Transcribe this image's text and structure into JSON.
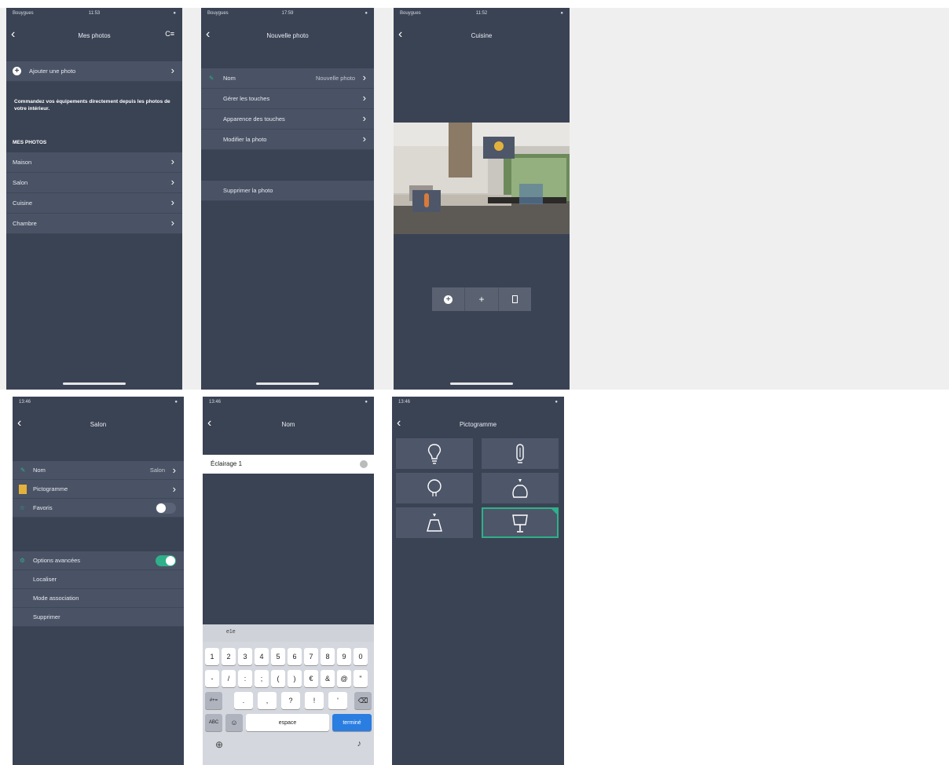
{
  "screens": {
    "mes_photos": {
      "status": {
        "left": "Bouygues",
        "time": "11:53",
        "right": "●"
      },
      "title": "Mes photos",
      "right_icon": "C≡",
      "add_label": "Ajouter une photo",
      "note": "Commandez vos équipements directement depuis les photos de votre intérieur.",
      "section": "MES PHOTOS",
      "items": [
        "Maison",
        "Salon",
        "Cuisine",
        "Chambre"
      ]
    },
    "nouvelle_photo": {
      "status": {
        "left": "Bouygues",
        "time": "17:59",
        "right": "●"
      },
      "title": "Nouvelle photo",
      "rows": [
        {
          "label": "Nom",
          "value": "Nouvelle photo"
        },
        {
          "label": "Gérer les touches",
          "value": ""
        },
        {
          "label": "Apparence des touches",
          "value": ""
        },
        {
          "label": "Modifier la photo",
          "value": ""
        }
      ],
      "delete_label": "Supprimer la photo"
    },
    "cuisine": {
      "status": {
        "left": "Bouygues",
        "time": "11:52",
        "right": "●"
      },
      "title": "Cuisine"
    },
    "salon": {
      "status": {
        "left": "13:46",
        "time": "",
        "right": "●"
      },
      "title": "Salon",
      "rows": [
        {
          "label": "Nom",
          "value": "Salon"
        },
        {
          "label": "Pictogramme",
          "value": ""
        },
        {
          "label": "Favoris",
          "value": ""
        }
      ],
      "options": [
        {
          "label": "Options avancées"
        },
        {
          "label": "Localiser"
        },
        {
          "label": "Mode association"
        },
        {
          "label": "Supprimer"
        }
      ]
    },
    "nom": {
      "status": {
        "left": "13:46",
        "time": "",
        "right": "●"
      },
      "title": "Nom",
      "input_value": "Éclairage 1",
      "suggestion": "e1e",
      "keys_row1": [
        "1",
        "2",
        "3",
        "4",
        "5",
        "6",
        "7",
        "8",
        "9",
        "0"
      ],
      "keys_row2": [
        "-",
        "/",
        ":",
        ";",
        "(",
        ")",
        "€",
        "&",
        "@",
        "\""
      ],
      "keys_row3": [
        ".",
        ",",
        "?",
        "!",
        "'"
      ],
      "key_123": "#+=",
      "key_abc": "ABC",
      "key_space": "espace",
      "key_done": "terminé"
    },
    "pictogramme": {
      "status": {
        "left": "13:46",
        "time": "",
        "right": "●"
      },
      "title": "Pictogramme"
    }
  },
  "colors": {
    "panel": "#3a4354",
    "row": "#4a5365",
    "accent": "#2fb08a",
    "blue": "#2a7de1"
  }
}
